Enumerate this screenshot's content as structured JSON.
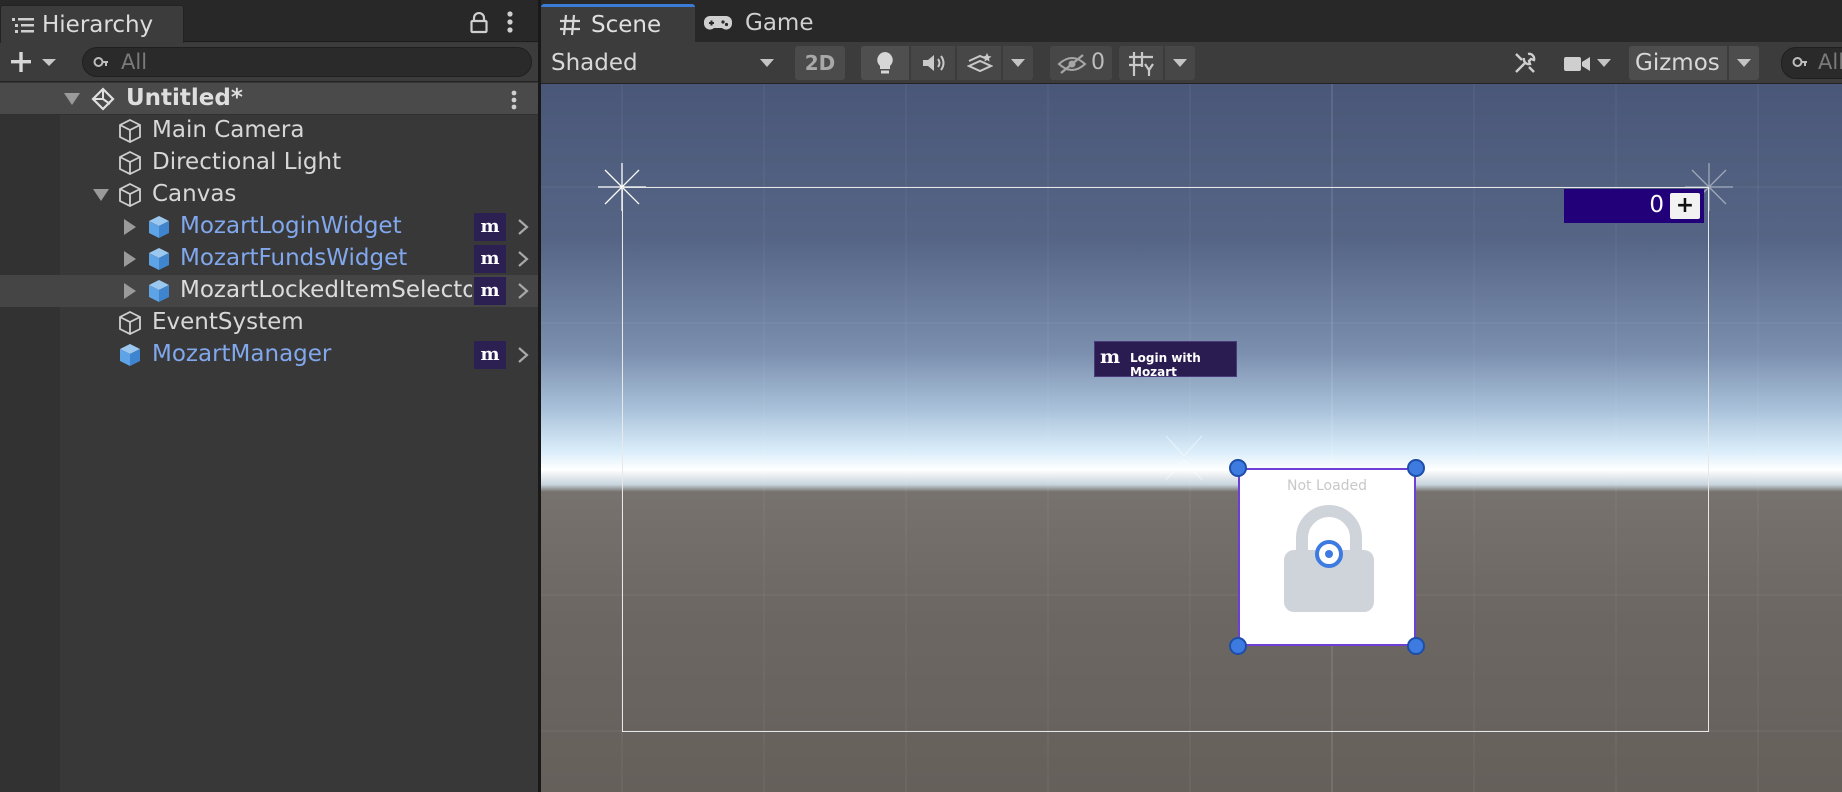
{
  "hierarchy": {
    "tab_title": "Hierarchy",
    "search_placeholder": "All",
    "scene_name": "Untitled*",
    "items": [
      {
        "label": "Main Camera"
      },
      {
        "label": "Directional Light"
      },
      {
        "label": "Canvas"
      },
      {
        "label": "MozartLoginWidget",
        "badge": "m"
      },
      {
        "label": "MozartFundsWidget",
        "badge": "m"
      },
      {
        "label": "MozartLockedItemSelecto",
        "badge": "m"
      },
      {
        "label": "EventSystem"
      },
      {
        "label": "MozartManager",
        "badge": "m"
      }
    ]
  },
  "scene_view": {
    "tabs": [
      {
        "label": "Scene"
      },
      {
        "label": "Game"
      }
    ],
    "shading_mode": "Shaded",
    "mode_2d_label": "2D",
    "hidden_count": "0",
    "gizmos_label": "Gizmos",
    "search_placeholder": "All"
  },
  "canvas_ui": {
    "funds_amount": "0",
    "funds_plus": "+",
    "login_button_label": "Login with Mozart",
    "login_button_logo": "m",
    "locked_item_status": "Not Loaded"
  },
  "colors": {
    "accent_tab": "#3a7bd5",
    "prefab_text": "#81a7ed",
    "mozart_badge_bg": "#2c1f52",
    "funds_widget_bg": "#22007a",
    "selection_outline": "#6d3fd6",
    "rect_handle": "#3d7be0"
  }
}
